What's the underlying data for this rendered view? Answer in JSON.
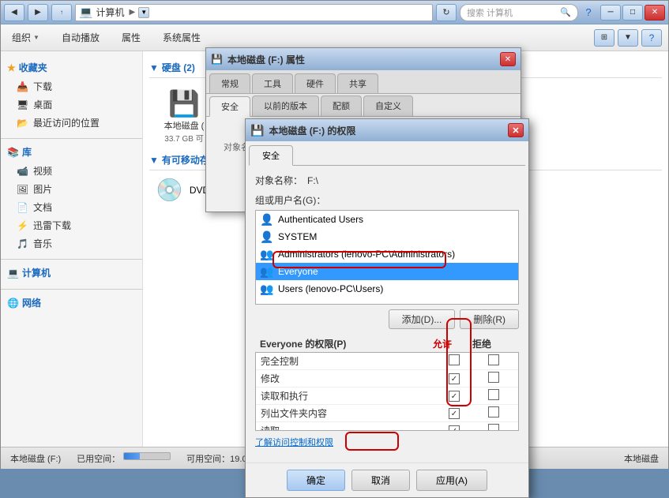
{
  "explorer": {
    "title": "计算机",
    "nav": {
      "back_label": "◀",
      "forward_label": "▶",
      "address": "计算机",
      "address_arrow": "▼",
      "search_placeholder": "搜索 计算机"
    },
    "controls": {
      "minimize": "─",
      "maximize": "□",
      "close": "✕"
    },
    "toolbar": {
      "organize": "组织",
      "autoplay": "自动播放",
      "properties": "属性",
      "system_props": "系统属性",
      "dropdown": "▼"
    },
    "sidebar": {
      "favorites_label": "收藏夹",
      "items": [
        {
          "label": "下载",
          "icon": "📥"
        },
        {
          "label": "桌面",
          "icon": "🖥"
        },
        {
          "label": "最近访问的位置",
          "icon": "📂"
        }
      ],
      "library_label": "库",
      "library_items": [
        {
          "label": "视频",
          "icon": "📹"
        },
        {
          "label": "图片",
          "icon": "🖼"
        },
        {
          "label": "文档",
          "icon": "📄"
        },
        {
          "label": "迅雷下载",
          "icon": "⚡"
        },
        {
          "label": "音乐",
          "icon": "🎵"
        }
      ],
      "computer_label": "计算机",
      "network_label": "网络"
    },
    "hard_drives": {
      "header": "硬盘 (2)",
      "items": [
        {
          "label": "本地磁盘 (",
          "size": "33.7 GB 可"
        }
      ]
    },
    "removable": {
      "header": "有可移动存储的",
      "items": [
        {
          "label": "DVD RW 驱",
          "icon": "💿"
        }
      ]
    },
    "status": {
      "drive_label": "本地磁盘 (F:)",
      "used_space": "已用空间：",
      "free_space": "可用空间：19.0 GB",
      "progress_pct": 35
    }
  },
  "dialog_properties": {
    "title": "本地磁盘 (F:) 属性",
    "close": "✕",
    "tabs": [
      {
        "label": "常规",
        "active": false
      },
      {
        "label": "工具",
        "active": false
      },
      {
        "label": "硬件",
        "active": false
      },
      {
        "label": "共享",
        "active": false
      },
      {
        "label": "安全",
        "active": true
      },
      {
        "label": "以前的版本",
        "active": false
      },
      {
        "label": "配额",
        "active": false
      },
      {
        "label": "自定义",
        "active": false
      }
    ],
    "security_tab_label": "安全"
  },
  "dialog_permissions": {
    "title": "本地磁盘 (F:) 的权限",
    "close": "✕",
    "security_tab": "安全",
    "object_label": "对象名称：",
    "object_path": "F:\\",
    "group_label": "组或用户名(G)：",
    "users": [
      {
        "name": "Authenticated Users",
        "selected": false
      },
      {
        "name": "SYSTEM",
        "selected": false
      },
      {
        "name": "Administrators (lenovo-PC\\Administrators)",
        "selected": false
      },
      {
        "name": "Everyone",
        "selected": true
      },
      {
        "name": "Users (lenovo-PC\\Users)",
        "selected": false
      }
    ],
    "add_btn": "添加(D)...",
    "remove_btn": "删除(R)",
    "permissions_label": "Everyone 的权限(P)",
    "allow_label": "允许",
    "deny_label": "拒绝",
    "permissions": [
      {
        "name": "完全控制",
        "allow": false,
        "deny": false
      },
      {
        "name": "修改",
        "allow": true,
        "deny": false
      },
      {
        "name": "读取和执行",
        "allow": true,
        "deny": false
      },
      {
        "name": "列出文件夹内容",
        "allow": true,
        "deny": false
      },
      {
        "name": "读取",
        "allow": true,
        "deny": false
      }
    ],
    "link_label": "了解访问控制和权限",
    "ok_btn": "确定",
    "cancel_btn": "取消",
    "apply_btn": "应用(A)"
  }
}
